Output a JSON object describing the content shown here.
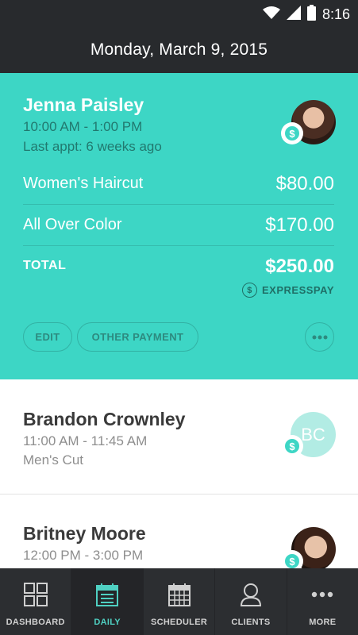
{
  "status": {
    "time": "8:16"
  },
  "header": {
    "date": "Monday, March 9, 2015"
  },
  "active": {
    "name": "Jenna Paisley",
    "time": "10:00 AM - 1:00 PM",
    "last_appt": "Last appt: 6 weeks ago",
    "services": [
      {
        "name": "Women's Haircut",
        "price": "$80.00"
      },
      {
        "name": "All Over Color",
        "price": "$170.00"
      }
    ],
    "total_label": "TOTAL",
    "total_value": "$250.00",
    "expresspay": "EXPRESSPAY",
    "buttons": {
      "edit": "EDIT",
      "other_payment": "OTHER PAYMENT"
    }
  },
  "appointments": [
    {
      "name": "Brandon Crownley",
      "time": "11:00 AM - 11:45 AM",
      "service": "Men's Cut",
      "initials": "BC"
    },
    {
      "name": "Britney Moore",
      "time": "12:00 PM - 3:00 PM"
    }
  ],
  "tabs": [
    {
      "label": "DASHBOARD",
      "icon": "dashboard-icon"
    },
    {
      "label": "DAILY",
      "icon": "calendar-list-icon",
      "active": true
    },
    {
      "label": "SCHEDULER",
      "icon": "calendar-grid-icon"
    },
    {
      "label": "CLIENTS",
      "icon": "person-icon"
    },
    {
      "label": "MORE",
      "icon": "more-dots-icon"
    }
  ],
  "colors": {
    "accent": "#3dd6c5",
    "dark": "#282a2d",
    "active_tab": "#4fd0c2"
  }
}
